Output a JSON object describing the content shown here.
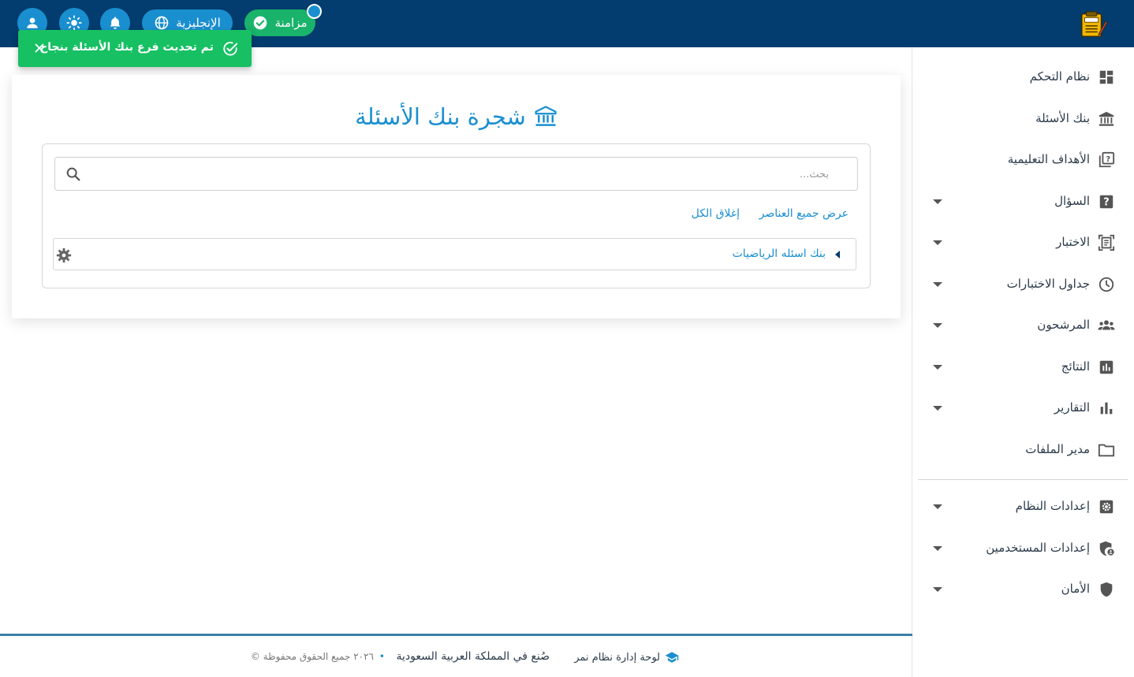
{
  "topbar": {
    "sync_label": "مزامنة",
    "lang_label": "الإنجليزية",
    "colors": {
      "bar": "#033c6e",
      "accent": "#1a8fd0",
      "success": "#19b36b"
    }
  },
  "toast": {
    "message": "تم تحديث فرع بنك الأسئلة بنجاح"
  },
  "sidebar": {
    "items": [
      {
        "label": "نظام التحكم",
        "icon": "dashboard-icon",
        "has_caret": false
      },
      {
        "label": "بنك الأسئلة",
        "icon": "bank-icon",
        "has_caret": false
      },
      {
        "label": "الأهداف التعليمية",
        "icon": "quiz-icon",
        "has_caret": false
      },
      {
        "label": "السؤال",
        "icon": "help-box-icon",
        "has_caret": true
      },
      {
        "label": "الاختبار",
        "icon": "document-scanner-icon",
        "has_caret": true
      },
      {
        "label": "جداول الاختبارات",
        "icon": "clock-icon",
        "has_caret": true
      },
      {
        "label": "المرشحون",
        "icon": "group-icon",
        "has_caret": true
      },
      {
        "label": "النتائج",
        "icon": "poll-icon",
        "has_caret": true
      },
      {
        "label": "التقارير",
        "icon": "bar-chart-icon",
        "has_caret": true
      },
      {
        "label": "مدير الملفات",
        "icon": "folder-icon",
        "has_caret": false
      },
      {
        "label": "إعدادات النظام",
        "icon": "settings-icon",
        "has_caret": true
      },
      {
        "label": "إعدادات المستخدمين",
        "icon": "admin-shield-icon",
        "has_caret": true
      },
      {
        "label": "الأمان",
        "icon": "shield-icon",
        "has_caret": true
      }
    ]
  },
  "main": {
    "title": "شجرة بنك الأسئلة",
    "search": {
      "placeholder": "بحث...",
      "value": ""
    },
    "expand_all": "عرض جميع العناصر",
    "collapse_all": "إغلاق الكل",
    "tree": [
      {
        "label": "بنك اسئله الرياضيات"
      }
    ]
  },
  "footer": {
    "brand": "لوحة إدارة نظام نمر",
    "made_in": "صُنع في المملكة العربية السعودية",
    "rights": "© ٢٠٢٦ جميع الحقوق محفوظة",
    "dot": "•"
  }
}
